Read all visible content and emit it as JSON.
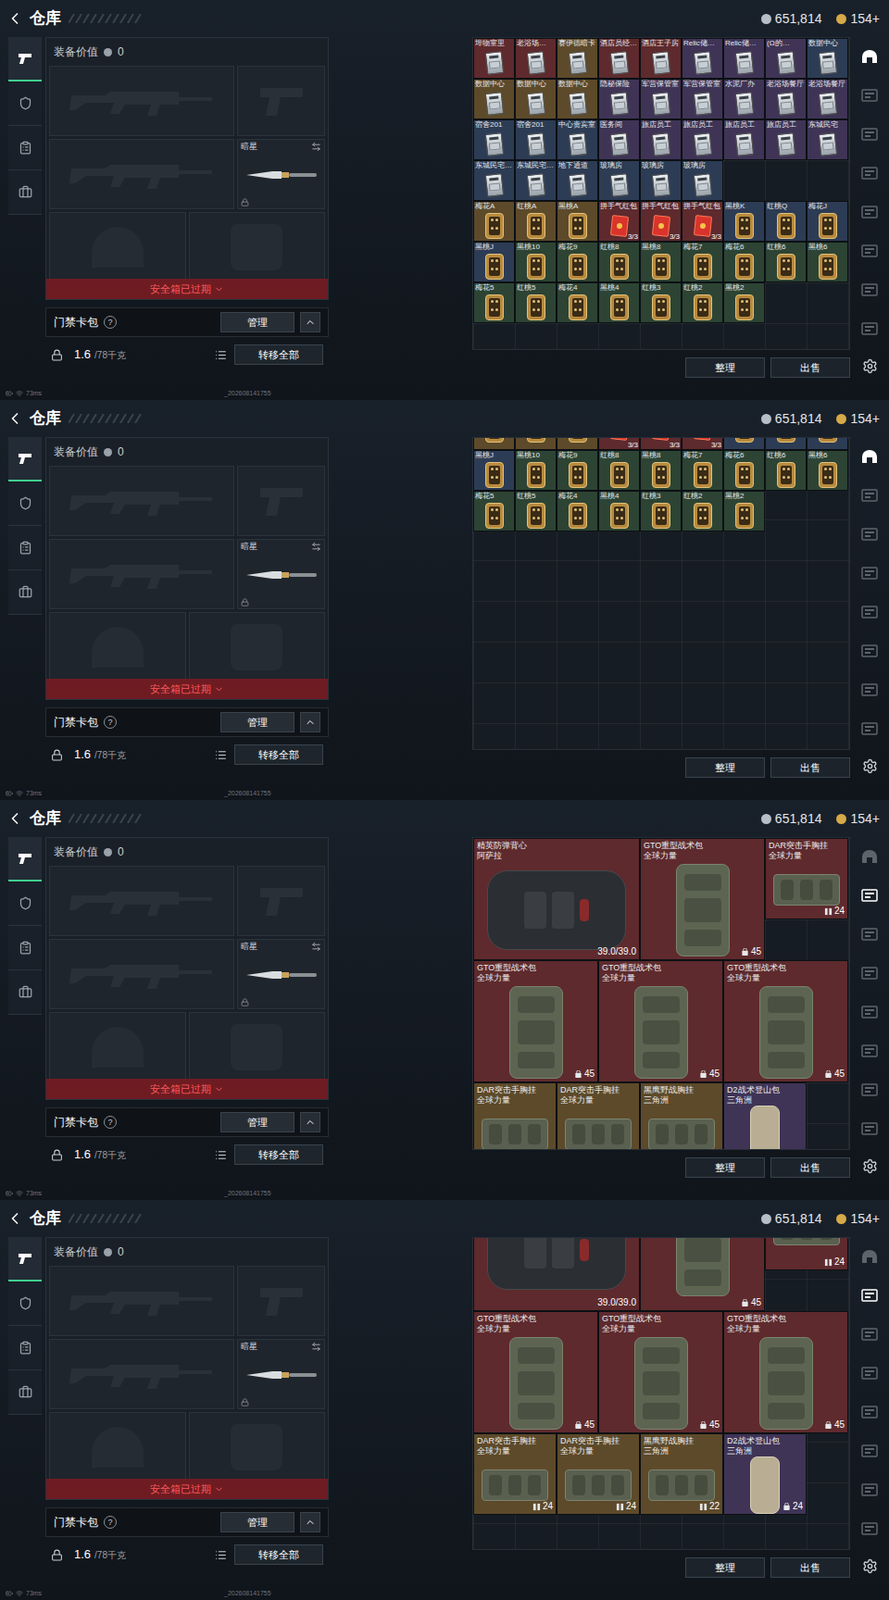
{
  "header": {
    "title": "仓库",
    "currencies": [
      {
        "amount": "651,814",
        "color": "#b8bec6"
      },
      {
        "amount": "154+",
        "color": "#d4a94a"
      }
    ]
  },
  "left_tabs": [
    {
      "selected": true
    },
    {
      "selected": false
    },
    {
      "selected": false
    },
    {
      "selected": false
    }
  ],
  "loadout": {
    "value_label": "装备价值",
    "value": "0",
    "melee_name": "暗星",
    "melee_locked": true,
    "banner": "安全箱已过期",
    "card_pack": {
      "label": "门禁卡包",
      "help": "?",
      "button": "管理"
    },
    "weight": {
      "current": "1.6",
      "max": "/78千克"
    },
    "transfer_button": "转移全部"
  },
  "grid_buttons": [
    "整理",
    "出售"
  ],
  "status_bar": {
    "ping": "73ms",
    "build": "_202608141755"
  },
  "screens": [
    {
      "kind": "cards",
      "scrolled": false,
      "side_tabs": [
        {
          "selected": true
        },
        {
          "selected": false
        },
        {
          "selected": false
        },
        {
          "selected": false
        },
        {
          "selected": false
        },
        {
          "selected": false
        },
        {
          "selected": false
        },
        {
          "selected": false
        }
      ],
      "rows": [
        [
          {
            "label": "埠物室里",
            "kind": "keycard",
            "color": "#5e2a2d"
          },
          {
            "label": "老浴场…",
            "kind": "keycard",
            "color": "#5e2a2d"
          },
          {
            "label": "赛伊德暗卡",
            "kind": "keycard",
            "color": "#5d4a2a"
          },
          {
            "label": "酒店员经…",
            "kind": "keycard",
            "color": "#5e2a2d"
          },
          {
            "label": "酒店王子房",
            "kind": "keycard",
            "color": "#5e2a2d"
          },
          {
            "label": "Relic储…",
            "kind": "keycard",
            "color": "#3f3456"
          },
          {
            "label": "Relic储…",
            "kind": "keycard",
            "color": "#3f3456"
          },
          {
            "label": "(Ω的…",
            "kind": "keycard",
            "color": "#3f3456"
          },
          {
            "label": "数据中心",
            "kind": "keycard",
            "color": "#2d3c55"
          }
        ],
        [
          {
            "label": "数据中心",
            "kind": "keycard",
            "color": "#5d4a2a"
          },
          {
            "label": "数据中心",
            "kind": "keycard",
            "color": "#5d4a2a"
          },
          {
            "label": "数据中心",
            "kind": "keycard",
            "color": "#5d4a2a"
          },
          {
            "label": "隐秘保险",
            "kind": "keycard",
            "color": "#3f3456"
          },
          {
            "label": "军营保管室",
            "kind": "keycard",
            "color": "#3f3456"
          },
          {
            "label": "军营保管室",
            "kind": "keycard",
            "color": "#3f3456"
          },
          {
            "label": "水泥厂办",
            "kind": "keycard",
            "color": "#3f3456"
          },
          {
            "label": "老浴场餐厅",
            "kind": "keycard",
            "color": "#3f3456"
          },
          {
            "label": "老浴场餐厅",
            "kind": "keycard",
            "color": "#3f3456"
          }
        ],
        [
          {
            "label": "宿舍201",
            "kind": "keycard",
            "color": "#2d3c55"
          },
          {
            "label": "宿舍201",
            "kind": "keycard",
            "color": "#2d3c55"
          },
          {
            "label": "中心贵宾室",
            "kind": "keycard",
            "color": "#2d3c55"
          },
          {
            "label": "医务间",
            "kind": "keycard",
            "color": "#3f3456"
          },
          {
            "label": "旅店员工",
            "kind": "keycard",
            "color": "#3f3456"
          },
          {
            "label": "旅店员工",
            "kind": "keycard",
            "color": "#3f3456"
          },
          {
            "label": "旅店员工",
            "kind": "keycard",
            "color": "#3f3456"
          },
          {
            "label": "旅店员工",
            "kind": "keycard",
            "color": "#3f3456"
          },
          {
            "label": "东城民宅",
            "kind": "keycard",
            "color": "#3f3456"
          }
        ],
        [
          {
            "label": "东城民宅…",
            "kind": "keycard",
            "color": "#2d3c55"
          },
          {
            "label": "东城民宅…",
            "kind": "keycard",
            "color": "#2d3c55"
          },
          {
            "label": "地下通道",
            "kind": "keycard",
            "color": "#2d3c55"
          },
          {
            "label": "玻璃房",
            "kind": "keycard",
            "color": "#2d3c55"
          },
          {
            "label": "玻璃房",
            "kind": "keycard",
            "color": "#2d3c55"
          },
          {
            "label": "玻璃房",
            "kind": "keycard",
            "color": "#2d3c55"
          }
        ],
        [
          {
            "label": "梅花A",
            "kind": "card",
            "color": "#5d4a2a"
          },
          {
            "label": "红桃A",
            "kind": "card",
            "color": "#5d4a2a"
          },
          {
            "label": "黑桃A",
            "kind": "card",
            "color": "#5d4a2a"
          },
          {
            "label": "拼手气红包",
            "kind": "red-packet",
            "color": "#5e2a2d",
            "count": "3/3"
          },
          {
            "label": "拼手气红包",
            "kind": "red-packet",
            "color": "#5e2a2d",
            "count": "3/3"
          },
          {
            "label": "拼手气红包",
            "kind": "red-packet",
            "color": "#5e2a2d",
            "count": "3/3"
          },
          {
            "label": "黑桃K",
            "kind": "card",
            "color": "#2d3c55"
          },
          {
            "label": "红桃Q",
            "kind": "card",
            "color": "#2d3c55"
          },
          {
            "label": "梅花J",
            "kind": "card",
            "color": "#2d3c55"
          }
        ],
        [
          {
            "label": "黑桃J",
            "kind": "card",
            "color": "#2d3c55"
          },
          {
            "label": "黑桃10",
            "kind": "card",
            "color": "#2d4434"
          },
          {
            "label": "梅花9",
            "kind": "card",
            "color": "#2d4434"
          },
          {
            "label": "红桃8",
            "kind": "card",
            "color": "#2d4434"
          },
          {
            "label": "黑桃8",
            "kind": "card",
            "color": "#2d4434"
          },
          {
            "label": "梅花7",
            "kind": "card",
            "color": "#2d4434"
          },
          {
            "label": "梅花6",
            "kind": "card",
            "color": "#2d4434"
          },
          {
            "label": "红桃6",
            "kind": "card",
            "color": "#2d4434"
          },
          {
            "label": "黑桃6",
            "kind": "card",
            "color": "#2d4434"
          }
        ],
        [
          {
            "label": "梅花5",
            "kind": "card",
            "color": "#2d4434"
          },
          {
            "label": "红桃5",
            "kind": "card",
            "color": "#2d4434"
          },
          {
            "label": "梅花4",
            "kind": "card",
            "color": "#2d4434"
          },
          {
            "label": "黑桃4",
            "kind": "card",
            "color": "#2d4434"
          },
          {
            "label": "红桃3",
            "kind": "card",
            "color": "#2d4434"
          },
          {
            "label": "红桃2",
            "kind": "card",
            "color": "#2d4434"
          },
          {
            "label": "黑桃2",
            "kind": "card",
            "color": "#2d4434"
          }
        ]
      ]
    },
    {
      "kind": "cards",
      "scrolled": true,
      "side_tabs": [
        {
          "selected": true
        },
        {
          "selected": false
        },
        {
          "selected": false
        },
        {
          "selected": false
        },
        {
          "selected": false
        },
        {
          "selected": false
        },
        {
          "selected": false
        },
        {
          "selected": false
        }
      ],
      "rows": [
        [
          {
            "kind": "card",
            "color": "#5d4a2a"
          },
          {
            "kind": "card",
            "color": "#5d4a2a"
          },
          {
            "kind": "card",
            "color": "#5d4a2a"
          },
          {
            "kind": "red-packet",
            "color": "#5e2a2d",
            "count": "3/3"
          },
          {
            "kind": "red-packet",
            "color": "#5e2a2d",
            "count": "3/3"
          },
          {
            "kind": "red-packet",
            "color": "#5e2a2d",
            "count": "3/3"
          },
          {
            "kind": "card",
            "color": "#2d3c55"
          },
          {
            "kind": "card",
            "color": "#2d3c55"
          },
          {
            "kind": "card",
            "color": "#2d3c55"
          }
        ],
        [
          {
            "label": "黑桃J",
            "kind": "card",
            "color": "#2d3c55"
          },
          {
            "label": "黑桃10",
            "kind": "card",
            "color": "#2d4434"
          },
          {
            "label": "梅花9",
            "kind": "card",
            "color": "#2d4434"
          },
          {
            "label": "红桃8",
            "kind": "card",
            "color": "#2d4434"
          },
          {
            "label": "黑桃8",
            "kind": "card",
            "color": "#2d4434"
          },
          {
            "label": "梅花7",
            "kind": "card",
            "color": "#2d4434"
          },
          {
            "label": "梅花6",
            "kind": "card",
            "color": "#2d4434"
          },
          {
            "label": "红桃6",
            "kind": "card",
            "color": "#2d4434"
          },
          {
            "label": "黑桃6",
            "kind": "card",
            "color": "#2d4434"
          }
        ],
        [
          {
            "label": "梅花5",
            "kind": "card",
            "color": "#2d4434"
          },
          {
            "label": "红桃5",
            "kind": "card",
            "color": "#2d4434"
          },
          {
            "label": "梅花4",
            "kind": "card",
            "color": "#2d4434"
          },
          {
            "label": "黑桃4",
            "kind": "card",
            "color": "#2d4434"
          },
          {
            "label": "红桃3",
            "kind": "card",
            "color": "#2d4434"
          },
          {
            "label": "红桃2",
            "kind": "card",
            "color": "#2d4434"
          },
          {
            "label": "黑桃2",
            "kind": "card",
            "color": "#2d4434"
          }
        ]
      ]
    },
    {
      "kind": "gear",
      "scrolled": false,
      "side_tabs": [
        {
          "selected": false
        },
        {
          "selected": true
        },
        {
          "selected": false
        },
        {
          "selected": false
        },
        {
          "selected": false
        },
        {
          "selected": false
        },
        {
          "selected": false
        },
        {
          "selected": false
        }
      ],
      "items": [
        {
          "name": "精英防弹背心",
          "sub": "阿萨拉",
          "badge": "39.0/39.0",
          "kind": "vest",
          "color": "#5e2a2d"
        },
        {
          "name": "GTO重型战术包",
          "sub": "全球力量",
          "badge": "45",
          "kind": "backpack",
          "color": "#5e2a2d"
        },
        {
          "name": "DAR突击手胸挂",
          "sub": "全球力量",
          "badge": "24",
          "kind": "chest-rig",
          "color": "#5e2a2d"
        },
        {
          "name": "GTO重型战术包",
          "sub": "全球力量",
          "badge": "45",
          "kind": "backpack",
          "color": "#5e2a2d"
        },
        {
          "name": "GTO重型战术包",
          "sub": "全球力量",
          "badge": "45",
          "kind": "backpack",
          "color": "#5e2a2d"
        },
        {
          "name": "GTO重型战术包",
          "sub": "全球力量",
          "badge": "45",
          "kind": "backpack",
          "color": "#5e2a2d"
        },
        {
          "name": "DAR突击手胸挂",
          "sub": "全球力量",
          "kind": "chest-rig",
          "color": "#5d4a2a"
        },
        {
          "name": "DAR突击手胸挂",
          "sub": "全球力量",
          "kind": "chest-rig",
          "color": "#5d4a2a"
        },
        {
          "name": "黑鹰野战胸挂",
          "sub": "三角洲",
          "kind": "chest-rig",
          "color": "#5d4a2a"
        },
        {
          "name": "D2战术登山包",
          "sub": "三角洲",
          "kind": "daypack",
          "color": "#3f3456"
        }
      ]
    },
    {
      "kind": "gear",
      "scrolled": true,
      "side_tabs": [
        {
          "selected": false
        },
        {
          "selected": true
        },
        {
          "selected": false
        },
        {
          "selected": false
        },
        {
          "selected": false
        },
        {
          "selected": false
        },
        {
          "selected": false
        },
        {
          "selected": false
        }
      ],
      "items": [
        {
          "badge": "39.0/39.0",
          "kind": "vest",
          "color": "#5e2a2d"
        },
        {
          "badge": "45",
          "kind": "backpack",
          "color": "#5e2a2d"
        },
        {
          "badge": "24",
          "kind": "chest-rig",
          "color": "#5e2a2d"
        },
        {
          "name": "GTO重型战术包",
          "sub": "全球力量",
          "badge": "45",
          "kind": "backpack",
          "color": "#5e2a2d"
        },
        {
          "name": "GTO重型战术包",
          "sub": "全球力量",
          "badge": "45",
          "kind": "backpack",
          "color": "#5e2a2d"
        },
        {
          "name": "GTO重型战术包",
          "sub": "全球力量",
          "badge": "45",
          "kind": "backpack",
          "color": "#5e2a2d"
        },
        {
          "name": "DAR突击手胸挂",
          "sub": "全球力量",
          "badge": "24",
          "kind": "chest-rig",
          "color": "#5d4a2a"
        },
        {
          "name": "DAR突击手胸挂",
          "sub": "全球力量",
          "badge": "24",
          "kind": "chest-rig",
          "color": "#5d4a2a"
        },
        {
          "name": "黑鹰野战胸挂",
          "sub": "三角洲",
          "badge": "22",
          "kind": "chest-rig",
          "color": "#5d4a2a"
        },
        {
          "name": "D2战术登山包",
          "sub": "三角洲",
          "badge": "24",
          "kind": "daypack",
          "color": "#3f3456"
        }
      ]
    }
  ]
}
